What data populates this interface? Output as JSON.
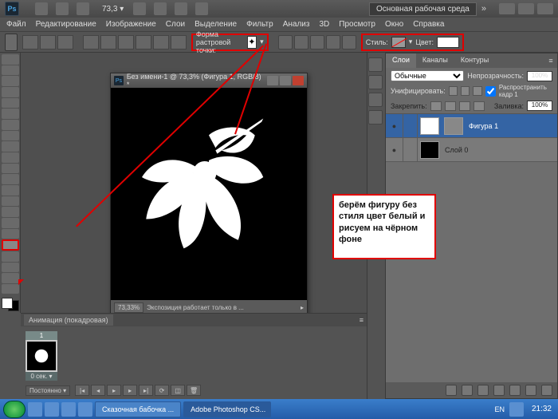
{
  "titlebar": {
    "logo": "Ps",
    "zoom": "73,3",
    "workspace": "Основная рабочая среда",
    "chev": "»"
  },
  "menu": {
    "file": "Файл",
    "edit": "Редактирование",
    "image": "Изображение",
    "layer": "Слои",
    "select": "Выделение",
    "filter": "Фильтр",
    "analysis": "Анализ",
    "threeD": "3D",
    "view": "Просмотр",
    "window": "Окно",
    "help": "Справка"
  },
  "optbar": {
    "shape_label": "Форма растровой точки:",
    "style_label": "Стиль:",
    "color_label": "Цвет:"
  },
  "doc": {
    "title": "Без имени-1 @ 73,3% (Фигура 1, RGB/8) *",
    "zoom_pct": "73,33%",
    "status": "Экспозиция работает только в ..."
  },
  "panels": {
    "tabs": {
      "layers": "Слои",
      "channels": "Каналы",
      "paths": "Контуры"
    },
    "blend": "Обычные",
    "opacity_label": "Непрозрачность:",
    "opacity": "100%",
    "unified_label": "Унифицировать:",
    "propagate": "Распространить кадр 1",
    "lock_label": "Закрепить:",
    "fill_label": "Заливка:",
    "fill": "100%",
    "layers": {
      "shape1": "Фигура 1",
      "layer0": "Слой 0"
    }
  },
  "animation": {
    "tab": "Анимация (покадровая)",
    "frame_num": "1",
    "frame_time": "0 сек.",
    "loop": "Постоянно"
  },
  "annotation": {
    "text": "берём фигуру без стиля цвет белый и рисуем на чёрном фоне"
  },
  "taskbar": {
    "task1": "Сказочная бабочка ...",
    "task2": "Adobe Photoshop CS...",
    "lang": "EN",
    "time": "21:32"
  }
}
